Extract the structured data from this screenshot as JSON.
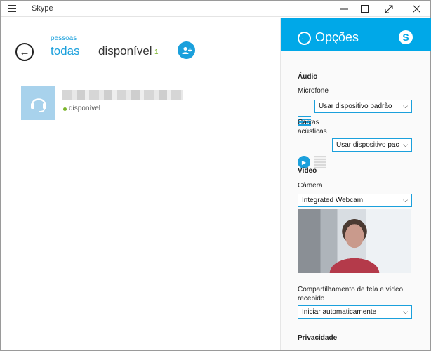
{
  "window": {
    "title": "Skype"
  },
  "left": {
    "pivot_super": "pessoas",
    "pivot_all": "todas",
    "pivot_available": "disponível",
    "available_count": "1",
    "contact": {
      "status": "disponível"
    }
  },
  "options": {
    "title": "Opções",
    "audio": {
      "heading": "Áudio",
      "mic_label": "Microfone",
      "mic_value": "Usar dispositivo padrão",
      "speaker_label_1": "Caixas",
      "speaker_label_2": "acústicas",
      "speaker_value": "Usar dispositivo pac"
    },
    "video": {
      "heading": "Vídeo",
      "camera_label": "Câmera",
      "camera_value": "Integrated Webcam"
    },
    "screen_share": {
      "label_1": "Compartilhamento de tela e vídeo",
      "label_2": "recebido",
      "value": "Iniciar automaticamente"
    },
    "privacy": {
      "heading": "Privacidade"
    }
  },
  "colors": {
    "accent": "#00a8e8",
    "presence": "#7bb52a"
  }
}
